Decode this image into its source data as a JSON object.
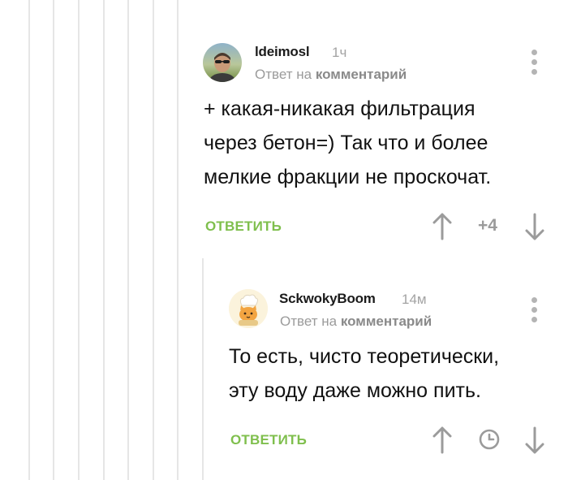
{
  "colors": {
    "accent": "#7fbf4d",
    "thread_line": "#e6e6e6",
    "muted_text": "#9b9b9b",
    "icon_gray": "#9b9b9b"
  },
  "comments": [
    {
      "author": "ldeimosl",
      "time": "1ч",
      "reply_prefix": "Ответ на",
      "reply_target": "комментарий",
      "lines": [
        "+ какая-никакая фильтрация",
        "через бетон=) Так что и более",
        "мелкие фракции не проскочат."
      ],
      "reply_label": "ОТВЕТИТЬ",
      "rating": "+4",
      "avatar_icon": "user-photo-avatar",
      "menu_icon": "kebab-menu-icon"
    },
    {
      "author": "SckwokyBoom",
      "time": "14м",
      "reply_prefix": "Ответ на",
      "reply_target": "комментарий",
      "lines": [
        "То есть, чисто теоретически,",
        "эту воду даже можно пить."
      ],
      "reply_label": "ОТВЕТИТЬ",
      "rating_icon": "clock-icon",
      "avatar_icon": "chef-cat-avatar",
      "menu_icon": "kebab-menu-icon"
    }
  ]
}
